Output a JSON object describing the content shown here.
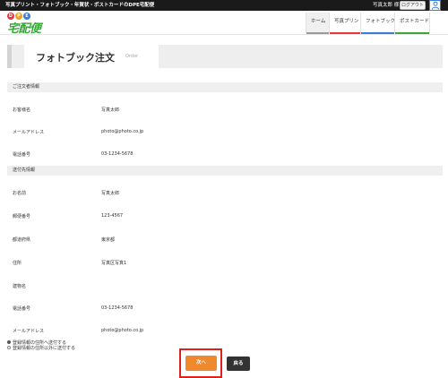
{
  "topbar": {
    "tagline": "写真プリント・フォトブック・年賀状・ポストカードのDPE宅配便",
    "user_name": "写真太郎 様",
    "logout_label": "ログアウト"
  },
  "logo": {
    "letters": [
      "D",
      "P",
      "E"
    ],
    "letter_colors": [
      "#e8383d",
      "#f0a020",
      "#3b7dd8"
    ],
    "main": "宅配便",
    "main_color": "#38a838"
  },
  "nav": {
    "tabs": [
      {
        "label": "ホーム",
        "color": "#999999"
      },
      {
        "label": "写真プリント",
        "color": "#e8383d"
      },
      {
        "label": "フォトブック",
        "color": "#3b7dd8"
      },
      {
        "label": "ポストカード",
        "color": "#38a838"
      }
    ]
  },
  "page": {
    "title": "フォトブック注文",
    "subtitle": "Order"
  },
  "orderer": {
    "heading": "ご注文者情報",
    "fields": [
      {
        "label": "お客様名",
        "value": "写真太郎"
      },
      {
        "label": "メールアドレス",
        "value": "photo@photo.co.jp"
      },
      {
        "label": "電話番号",
        "value": "03-1234-5678"
      }
    ]
  },
  "shipping": {
    "heading": "送付先情報",
    "fields": [
      {
        "label": "お名前",
        "value": "写真太郎"
      },
      {
        "label": "郵便番号",
        "value": "123-4567"
      },
      {
        "label": "都道府県",
        "value": "東京都"
      },
      {
        "label": "住所",
        "value": "写真区写真1"
      },
      {
        "label": "建物名",
        "value": ""
      },
      {
        "label": "電話番号",
        "value": "03-1234-5678"
      },
      {
        "label": "メールアドレス",
        "value": "photo@photo.co.jp"
      }
    ]
  },
  "delivery_options": [
    {
      "label": "登録情報の住所へ送付する",
      "checked": true
    },
    {
      "label": "登録情報の住所以外に送付する",
      "checked": false
    }
  ],
  "buttons": {
    "next": "次へ",
    "back": "戻る"
  },
  "colors": {
    "accent_orange": "#f0882c",
    "highlight_red": "#e0201b",
    "back_dark": "#333333"
  }
}
